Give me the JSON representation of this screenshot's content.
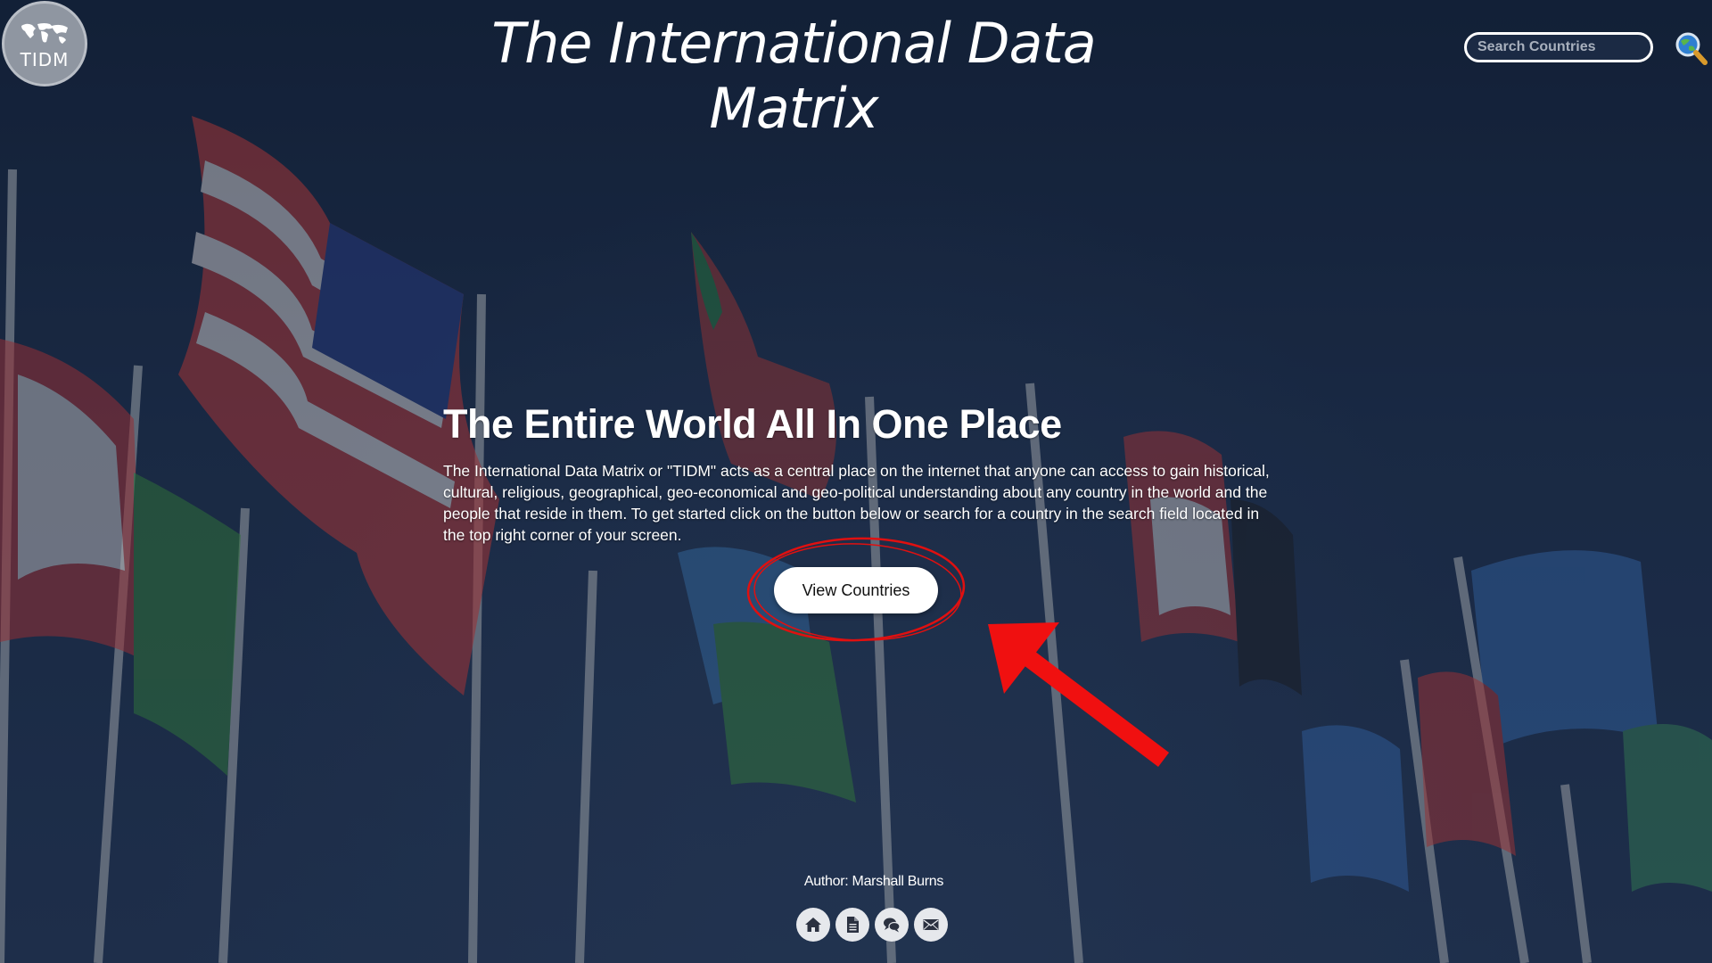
{
  "logo": {
    "text": "TIDM"
  },
  "header": {
    "title": "The International Data Matrix",
    "search_placeholder": "Search Countries",
    "search_icon": "magnifier-globe-icon"
  },
  "hero": {
    "title": "The Entire World All In One Place",
    "description": "The International Data Matrix or \"TIDM\" acts as a central place on the internet that anyone can access to gain historical, cultural, religious, geographical, geo-economical and geo-political understanding about any country in the world and the people that reside in them. To get started click on the button below or search for a country in the search field located in the top right corner of your screen.",
    "button_label": "View Countries"
  },
  "annotation": {
    "color": "#e01010"
  },
  "footer": {
    "author": "Author: Marshall Burns",
    "links": [
      {
        "icon": "home-icon"
      },
      {
        "icon": "document-icon"
      },
      {
        "icon": "chat-icon"
      },
      {
        "icon": "mail-icon"
      }
    ]
  },
  "colors": {
    "background": "#1d2b46",
    "text": "#ffffff",
    "button_bg": "#ffffff",
    "icon_bg": "#e6e8ec"
  }
}
